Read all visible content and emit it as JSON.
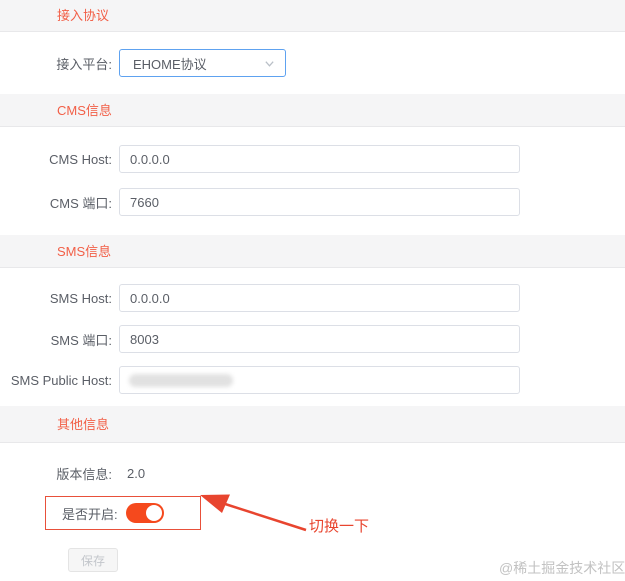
{
  "sections": {
    "protocol": {
      "title": "接入协议"
    },
    "cms": {
      "title": "CMS信息"
    },
    "sms": {
      "title": "SMS信息"
    },
    "other": {
      "title": "其他信息"
    }
  },
  "fields": {
    "platform": {
      "label": "接入平台:",
      "value": "EHOME协议"
    },
    "cms_host": {
      "label": "CMS Host:",
      "value": "0.0.0.0"
    },
    "cms_port": {
      "label": "CMS 端口:",
      "value": "7660"
    },
    "sms_host": {
      "label": "SMS Host:",
      "value": "0.0.0.0"
    },
    "sms_port": {
      "label": "SMS 端口:",
      "value": "8003"
    },
    "sms_public_host": {
      "label": "SMS Public Host:",
      "value": ""
    },
    "version": {
      "label": "版本信息:",
      "value": "2.0"
    },
    "enabled": {
      "label": "是否开启:",
      "state": "on"
    }
  },
  "buttons": {
    "save": "保存"
  },
  "annotation": {
    "text": "切换一下"
  },
  "watermark": "@稀土掘金技术社区",
  "colors": {
    "section_title": "#f25f47",
    "toggle_on": "#f5491d",
    "annotation_red": "#e8452f",
    "select_border": "#5ea2f0",
    "input_border": "#dcdfe6",
    "section_bar_bg": "#f5f5f6",
    "label_text": "#5a5e66",
    "watermark_text": "#c2c2c2"
  }
}
